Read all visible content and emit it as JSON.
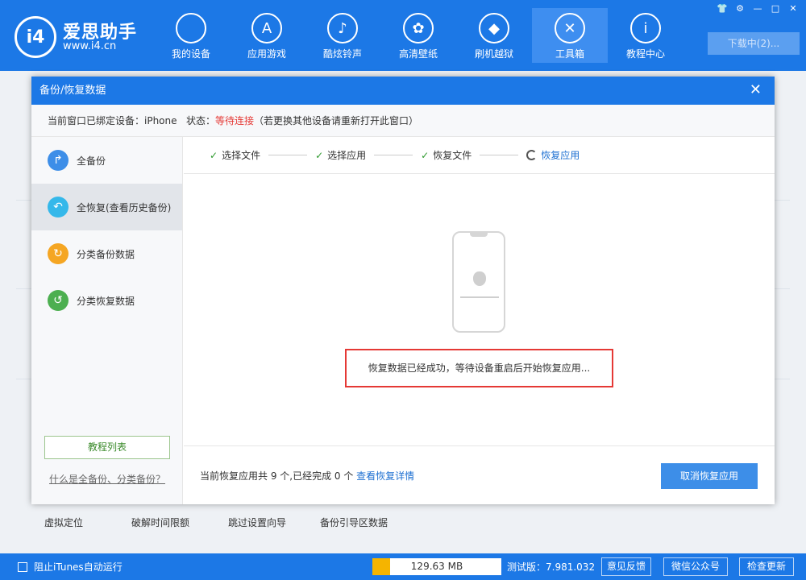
{
  "app": {
    "logo_mark": "i4",
    "name": "爱思助手",
    "url": "www.i4.cn",
    "download_button": "下载中(2)..."
  },
  "nav": [
    {
      "label": "我的设备",
      "icon": "apple-icon",
      "glyph": ""
    },
    {
      "label": "应用游戏",
      "icon": "appstore-icon",
      "glyph": "A"
    },
    {
      "label": "酷炫铃声",
      "icon": "bell-icon",
      "glyph": "♪"
    },
    {
      "label": "高清壁纸",
      "icon": "flower-icon",
      "glyph": "✿"
    },
    {
      "label": "刷机越狱",
      "icon": "dropbox-icon",
      "glyph": "◆"
    },
    {
      "label": "工具箱",
      "icon": "tools-icon",
      "glyph": "✕"
    },
    {
      "label": "教程中心",
      "icon": "info-icon",
      "glyph": "i"
    }
  ],
  "window_buttons": [
    "shirt-icon",
    "gear-icon",
    "minimize-icon",
    "maximize-icon",
    "close-icon"
  ],
  "background_tools": [
    "虚拟定位",
    "破解时间限额",
    "跳过设置向导",
    "备份引导区数据"
  ],
  "dialog": {
    "title": "备份/恢复数据",
    "close_glyph": "✕",
    "status_prefix": "当前窗口已绑定设备：iPhone   状态：",
    "status_value": "等待连接",
    "status_suffix": "（若更换其他设备请重新打开此窗口）",
    "sidebar": [
      {
        "label": "全备份",
        "icon": "backup-arrow-icon",
        "glyph": "↱",
        "color": "#3d8ee8"
      },
      {
        "label": "全恢复(查看历史备份)",
        "icon": "restore-arrow-icon",
        "glyph": "↶",
        "color": "#35b8ea"
      },
      {
        "label": "分类备份数据",
        "icon": "category-backup-icon",
        "glyph": "↻",
        "color": "#f5a623"
      },
      {
        "label": "分类恢复数据",
        "icon": "category-restore-icon",
        "glyph": "↺",
        "color": "#4caf50"
      }
    ],
    "tutorial_button": "教程列表",
    "faq_link": "什么是全备份、分类备份？",
    "steps": [
      {
        "label": "选择文件",
        "done": true
      },
      {
        "label": "选择应用",
        "done": true
      },
      {
        "label": "恢复文件",
        "done": true
      },
      {
        "label": "恢复应用",
        "done": false
      }
    ],
    "message": "恢复数据已经成功，等待设备重启后开始恢复应用...",
    "footer_prefix": "当前恢复应用共 9 个,已经完成 0 个",
    "footer_link": "查看恢复详情",
    "cancel_button": "取消恢复应用"
  },
  "statusbar": {
    "itunes_label": "阻止iTunes自动运行",
    "storage_text": "129.63 MB",
    "storage_fill": 0.14,
    "version": "测试版：7.981.032",
    "buttons": [
      "意见反馈",
      "微信公众号",
      "检查更新"
    ]
  },
  "colors": {
    "brand": "#1c78e6",
    "alert": "#e53935",
    "success": "#2e9a2e"
  }
}
